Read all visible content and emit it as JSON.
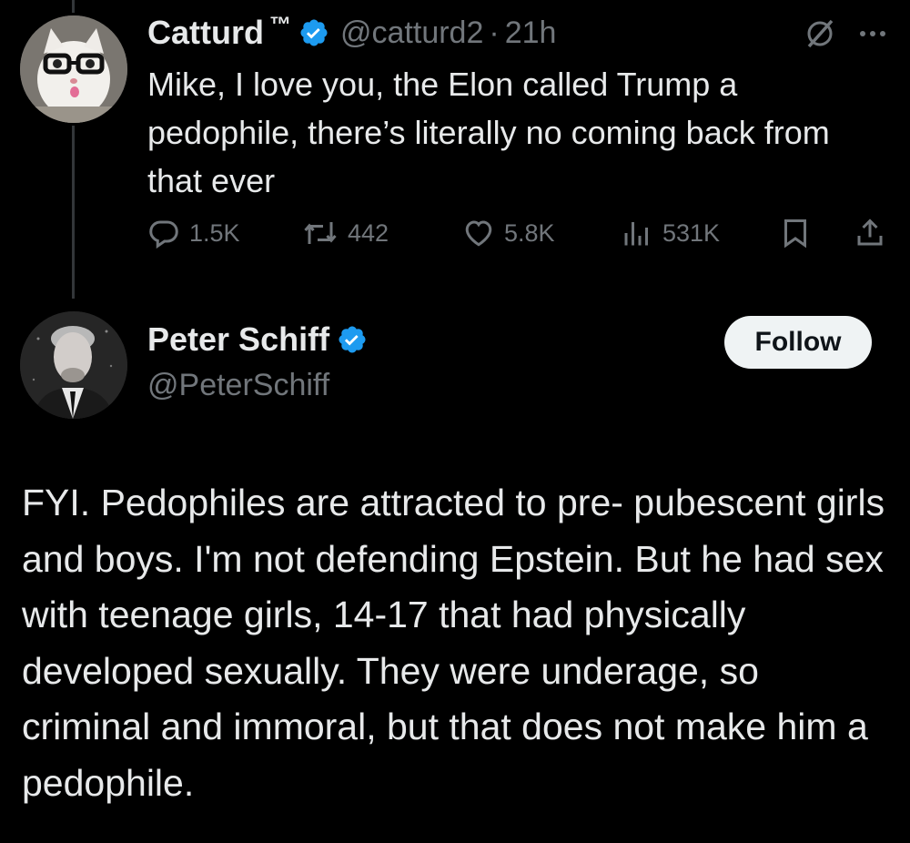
{
  "tweet1": {
    "name": "Catturd",
    "name_suffix": "™",
    "handle": "@catturd2",
    "separator": "·",
    "time": "21h",
    "text": "Mike, I love you, the Elon called Trump a pedophile, there’s literally no coming back from that ever",
    "stats": {
      "replies": "1.5K",
      "reposts": "442",
      "likes": "5.8K",
      "views": "531K"
    }
  },
  "tweet2": {
    "name": "Peter Schiff",
    "handle": "@PeterSchiff",
    "follow_label": "Follow",
    "text": "FYI. Pedophiles are attracted to pre- pubescent girls and boys.  I'm not defending Epstein. But he had sex with teenage girls, 14-17 that had physically developed sexually. They were underage, so criminal and immoral, but that does not make him a pedophile."
  },
  "colors": {
    "background": "#000000",
    "text_primary": "#e7e9ea",
    "text_secondary": "#71767b",
    "verified_blue": "#1d9bf0",
    "follow_bg": "#eff3f4"
  },
  "icons": [
    "verified-badge-icon",
    "grok-icon",
    "more-icon",
    "reply-icon",
    "repost-icon",
    "like-icon",
    "views-icon",
    "bookmark-icon",
    "share-icon"
  ]
}
